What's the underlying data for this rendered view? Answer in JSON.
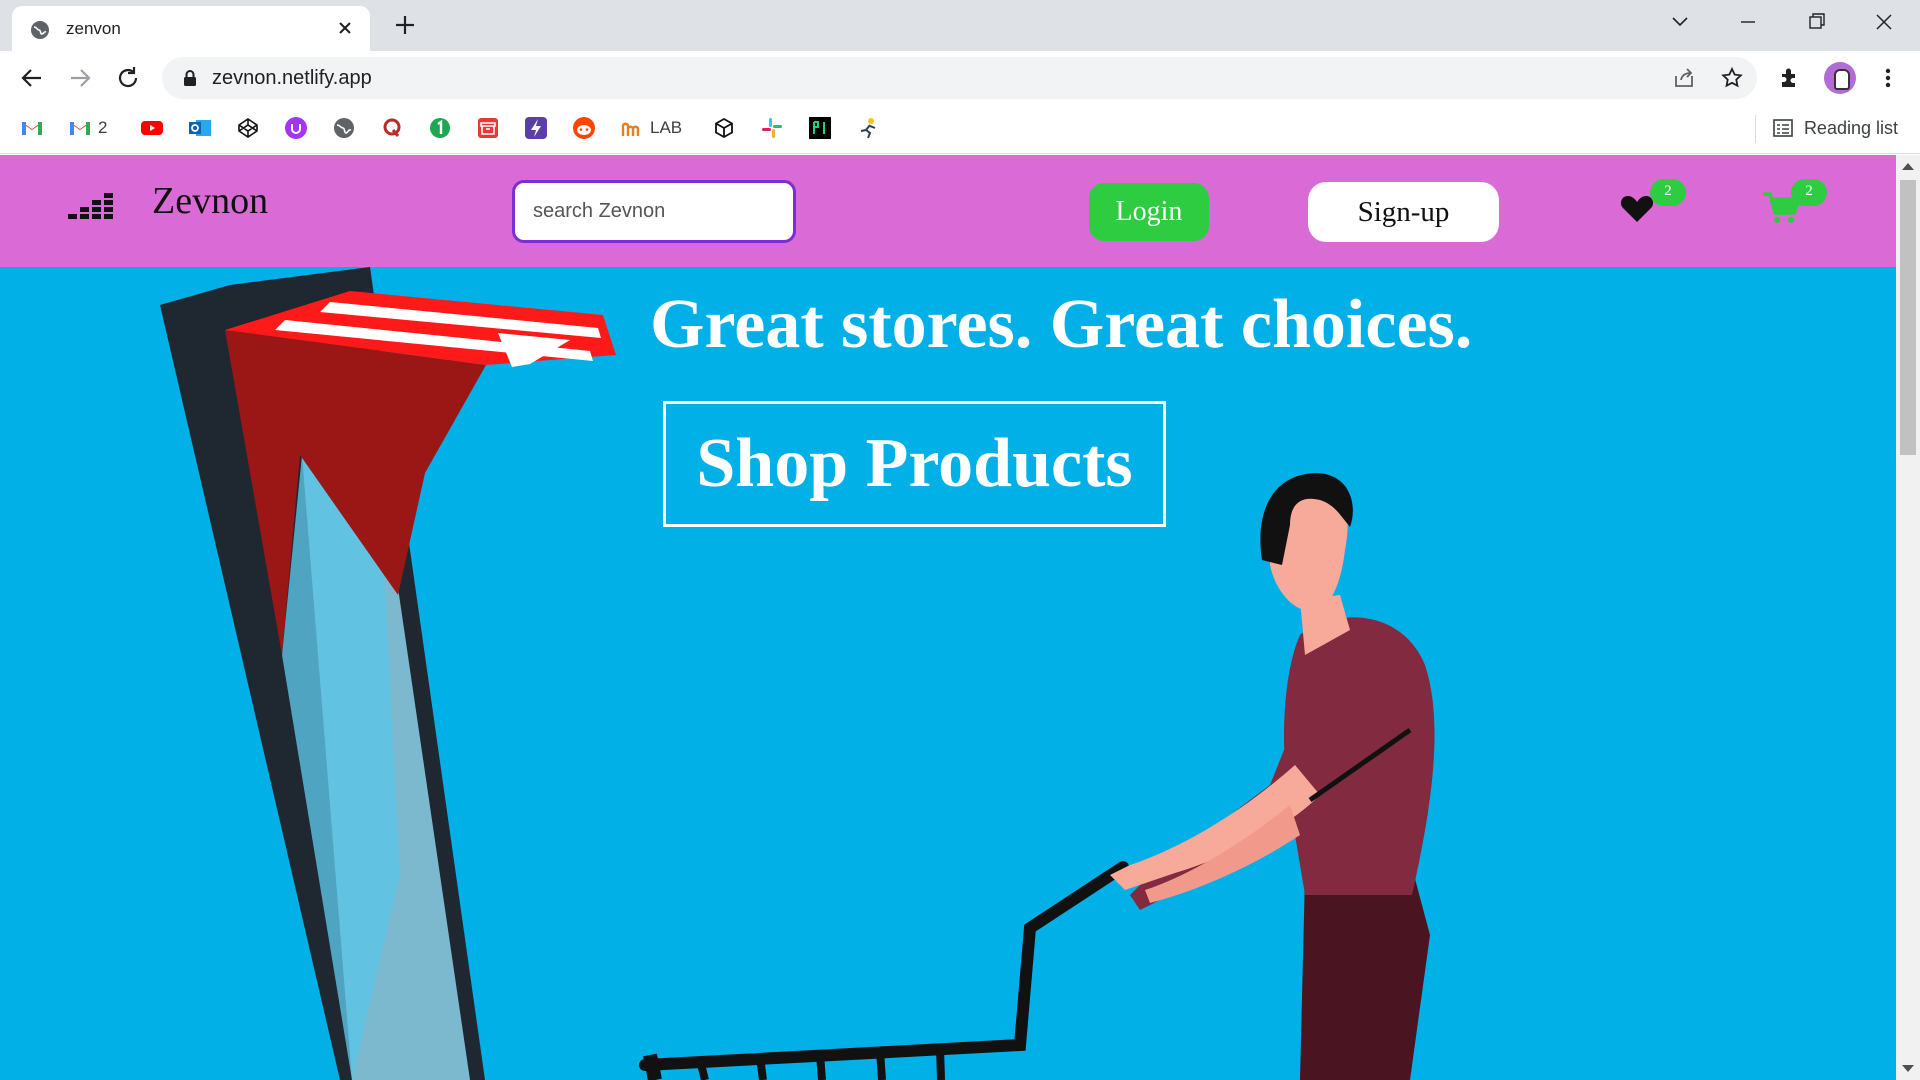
{
  "browser": {
    "tab_title": "zenvon",
    "url": "zevnon.netlify.app",
    "bookmarks": [
      {
        "icon": "gmail-icon",
        "label": ""
      },
      {
        "icon": "gmail-icon",
        "label": "2"
      },
      {
        "icon": "youtube-icon",
        "label": ""
      },
      {
        "icon": "outlook-icon",
        "label": ""
      },
      {
        "icon": "codepen-icon",
        "label": ""
      },
      {
        "icon": "udemy-icon",
        "label": ""
      },
      {
        "icon": "globe-icon",
        "label": ""
      },
      {
        "icon": "quora-icon",
        "label": ""
      },
      {
        "icon": "one-icon",
        "label": ""
      },
      {
        "icon": "archive-icon",
        "label": ""
      },
      {
        "icon": "bolt-icon",
        "label": ""
      },
      {
        "icon": "reddit-icon",
        "label": ""
      },
      {
        "icon": "lab-icon",
        "label": "LAB"
      },
      {
        "icon": "cube-icon",
        "label": ""
      },
      {
        "icon": "slack-icon",
        "label": ""
      },
      {
        "icon": "pi-icon",
        "label": ""
      },
      {
        "icon": "runner-icon",
        "label": ""
      }
    ],
    "reading_list_label": "Reading list"
  },
  "site": {
    "brand": "Zevnon",
    "search_placeholder": "search Zevnon",
    "login_label": "Login",
    "signup_label": "Sign-up",
    "wishlist_count": "2",
    "cart_count": "2",
    "hero_title": "Great stores. Great choices.",
    "cta_label": "Shop Products"
  },
  "colors": {
    "header_bg": "#da6ad6",
    "hero_bg": "#00b0e6",
    "login_bg": "#2ecc40",
    "search_border": "#7a2fd6"
  }
}
